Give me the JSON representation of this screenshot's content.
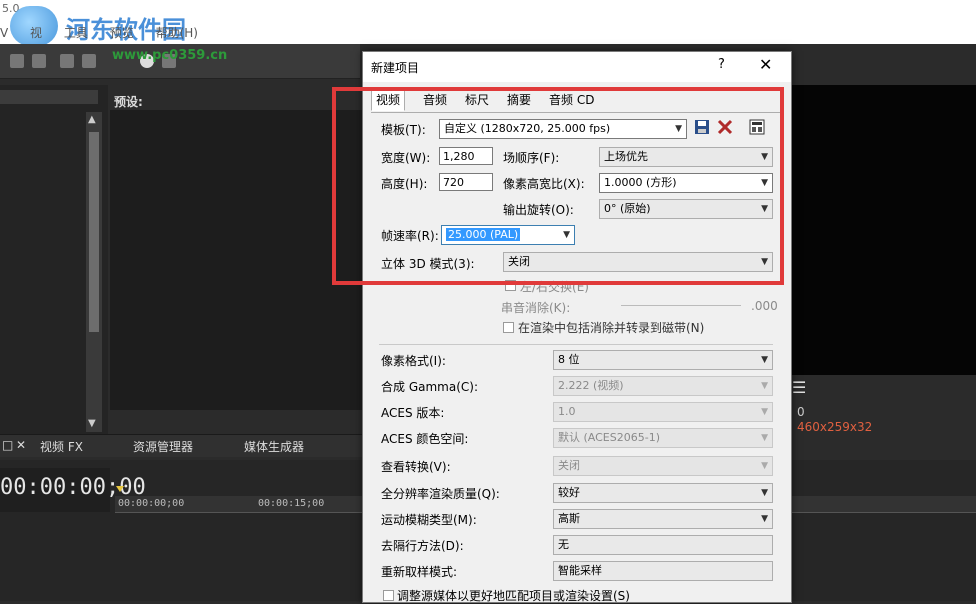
{
  "app": {
    "version": "5.0",
    "menu": [
      "V",
      "视",
      "工具",
      "预览",
      "帮助(H)"
    ],
    "watermark_name": "河东软件园",
    "watermark_url": "www.pc0359.cn",
    "preset_label": "预设:",
    "bottom_tabs": [
      "视频 FX",
      "资源管理器",
      "媒体生成器"
    ],
    "timecode": "00:00:00;00",
    "ruler_marks": [
      "00:00:00;00",
      "00:00:15;00"
    ],
    "info_zero": "0",
    "info_size": "460x259x32"
  },
  "dialog": {
    "title": "新建项目",
    "help": "?",
    "close": "✕",
    "tabs": [
      "视频",
      "音频",
      "标尺",
      "摘要",
      "音频 CD"
    ],
    "template_label": "模板(T):",
    "template_value": "自定义 (1280x720, 25.000 fps)",
    "width_label": "宽度(W):",
    "width_value": "1,280",
    "height_label": "高度(H):",
    "height_value": "720",
    "field_order_label": "场顺序(F):",
    "field_order_value": "上场优先",
    "pixel_aspect_label": "像素高宽比(X):",
    "pixel_aspect_value": "1.0000 (方形)",
    "output_rotation_label": "输出旋转(O):",
    "output_rotation_value": "0° (原始)",
    "frame_rate_label": "帧速率(R):",
    "frame_rate_value": "25.000 (PAL)",
    "stereo_label": "立体 3D 模式(3):",
    "stereo_value": "关闭",
    "swap_label": "左/右交换(E)",
    "crosstalk_label": "串音消除(K):",
    "crosstalk_value": ".000",
    "include_crosstalk_label": "在渲染中包括消除并转录到磁带(N)",
    "pixel_format_label": "像素格式(I):",
    "pixel_format_value": "8 位",
    "gamma_label": "合成 Gamma(C):",
    "gamma_value": "2.222 (视频)",
    "aces_version_label": "ACES 版本:",
    "aces_version_value": "1.0",
    "aces_color_label": "ACES 颜色空间:",
    "aces_color_value": "默认 (ACES2065-1)",
    "view_transform_label": "查看转换(V):",
    "view_transform_value": "关闭",
    "render_quality_label": "全分辨率渲染质量(Q):",
    "render_quality_value": "较好",
    "motion_blur_label": "运动模糊类型(M):",
    "motion_blur_value": "高斯",
    "deinterlace_label": "去隔行方法(D):",
    "deinterlace_value": "无",
    "resample_label": "重新取样模式:",
    "resample_value": "智能采样",
    "adjust_label": "调整源媒体以更好地匹配项目或渲染设置(S)"
  },
  "colors": {
    "highlight_box": "#e03a3a",
    "selection": "#3399ff"
  }
}
